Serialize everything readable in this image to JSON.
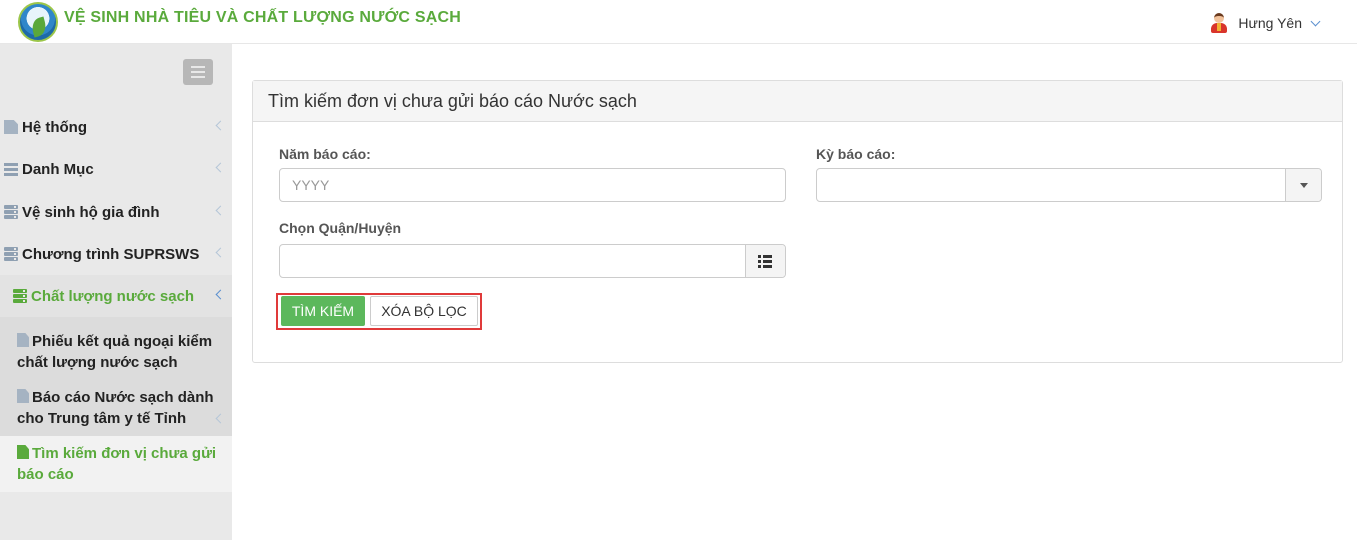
{
  "header": {
    "app_title": "VỆ SINH NHÀ TIÊU VÀ CHẤT LƯỢNG NƯỚC SẠCH",
    "user_name": "Hưng Yên",
    "brand_color": "#5aaa3c"
  },
  "sidebar": {
    "items": [
      {
        "label": "Hệ thống",
        "icon": "file-icon"
      },
      {
        "label": "Danh Mục",
        "icon": "list-icon"
      },
      {
        "label": "Vệ sinh hộ gia đình",
        "icon": "server-icon"
      },
      {
        "label": "Chương trình SUPRSWS",
        "icon": "server-icon"
      },
      {
        "label": "Chất lượng nước sạch",
        "icon": "server-icon",
        "active": true
      }
    ],
    "subitems": [
      {
        "label": "Phiếu kết quả ngoại kiểm chất lượng nước sạch",
        "icon": "file-icon"
      },
      {
        "label": "Báo cáo Nước sạch dành cho Trung tâm y tế Tỉnh",
        "icon": "file-icon"
      },
      {
        "label": "Tìm kiếm đơn vị chưa gửi báo cáo",
        "icon": "file-icon",
        "active": true
      }
    ]
  },
  "panel": {
    "title": "Tìm kiếm đơn vị chưa gửi báo cáo Nước sạch",
    "year_label": "Năm báo cáo:",
    "year_placeholder": "YYYY",
    "period_label": "Kỳ báo cáo:",
    "period_value": "",
    "district_label": "Chọn Quận/Huyện",
    "district_value": "",
    "search_button": "TÌM KIẾM",
    "clear_button": "XÓA BỘ LỌC",
    "highlight_color": "#e03a3a"
  }
}
